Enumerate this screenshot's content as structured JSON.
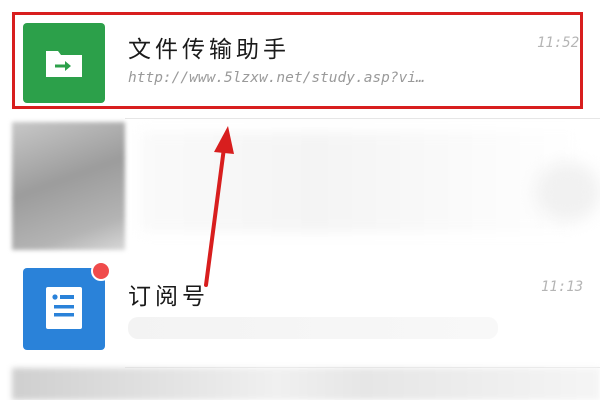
{
  "conversations": [
    {
      "id": "file-transfer",
      "title": "文件传输助手",
      "preview": "http://www.5lzxw.net/study.asp?vi…",
      "time": "11:52",
      "icon": "folder-arrow-icon",
      "avatar_color": "#2ca04a"
    },
    {
      "id": "subscriptions",
      "title": "订阅号",
      "time": "11:13",
      "icon": "document-icon",
      "avatar_color": "#2a82d9",
      "unread_badge": true
    }
  ],
  "annotation": {
    "highlight_color": "#d81e1e",
    "arrow_color": "#d81e1e"
  }
}
